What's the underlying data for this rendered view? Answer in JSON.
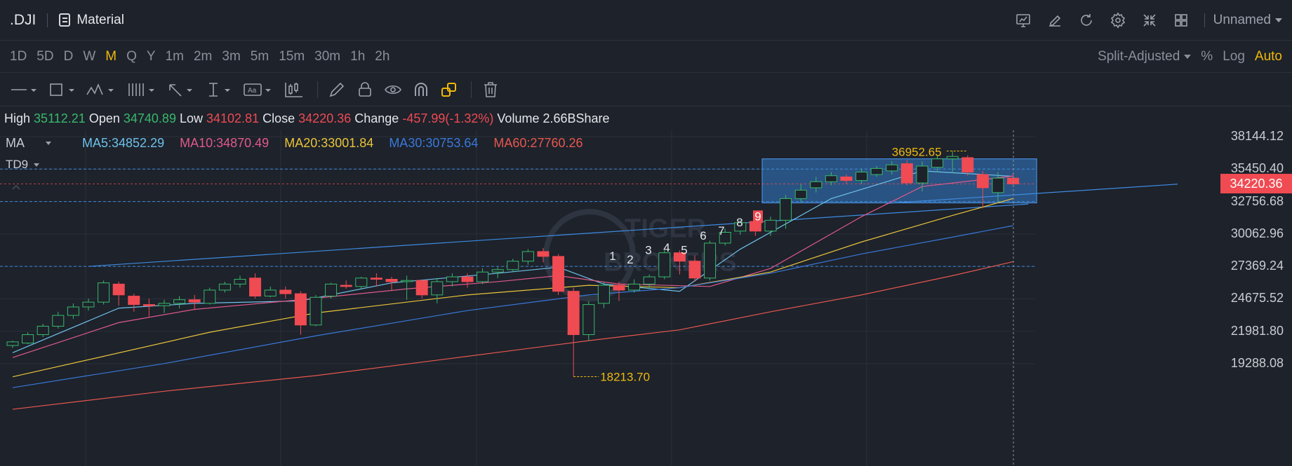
{
  "header": {
    "symbol": ".DJI",
    "layout_name": "Material",
    "icons": [
      "chart-screen-icon",
      "edit-icon",
      "refresh-icon",
      "settings-icon",
      "compress-icon",
      "grid-layout-icon"
    ],
    "account": "Unnamed"
  },
  "periods": [
    "1D",
    "5D",
    "D",
    "W",
    "M",
    "Q",
    "Y",
    "1m",
    "2m",
    "3m",
    "5m",
    "15m",
    "30m",
    "1h",
    "2h"
  ],
  "active_period": "M",
  "adjust": {
    "mode": "Split-Adjusted",
    "percent": "%",
    "log": "Log",
    "auto": "Auto"
  },
  "tools": [
    "line-tool-icon",
    "rectangle-tool-icon",
    "pattern-tool-icon",
    "fib-tool-icon",
    "arrow-tool-icon",
    "measure-tool-icon",
    "text-tool-icon",
    "indicator-icon",
    "pencil-icon",
    "lock-icon",
    "eye-icon",
    "magnet-icon",
    "link-icon",
    "trash-icon"
  ],
  "ohlc": {
    "high_label": "High",
    "high": "35112.21",
    "open_label": "Open",
    "open": "34740.89",
    "low_label": "Low",
    "low": "34102.81",
    "close_label": "Close",
    "close": "34220.36",
    "change_label": "Change",
    "change": "-457.99(-1.32%)",
    "volume_label": "Volume",
    "volume": "2.66BShare"
  },
  "indicators": {
    "ma_label": "MA",
    "ma5": "MA5:34852.29",
    "ma10": "MA10:34870.49",
    "ma20": "MA20:33001.84",
    "ma30": "MA30:30753.64",
    "ma60": "MA60:27760.26",
    "td_label": "TD9"
  },
  "colors": {
    "up": "#39b86b",
    "down": "#f04a52",
    "ma5": "#6ec1ea",
    "ma10": "#e0598b",
    "ma20": "#e9c43a",
    "ma30": "#3a78d8",
    "ma60": "#e8574e",
    "accent": "#f0b90b",
    "selection": "#2f6eb0"
  },
  "chart_data": {
    "type": "candlestick",
    "y_ticks": [
      "38144.12",
      "35450.40",
      "32756.68",
      "30062.96",
      "27369.24",
      "24675.52",
      "21981.80",
      "19288.08"
    ],
    "last_price": "34220.36",
    "high_marker": "36952.65",
    "low_marker": "18213.70",
    "td_counts": [
      "1",
      "2",
      "3",
      "4",
      "5",
      "6",
      "7",
      "8",
      "9"
    ],
    "watermark": [
      "TIGER",
      "BROKERS"
    ],
    "candles": [
      [
        20800,
        21100,
        20600,
        21200
      ],
      [
        21000,
        21700,
        20900,
        21900
      ],
      [
        21700,
        22400,
        21500,
        22600
      ],
      [
        22400,
        23300,
        22200,
        23600
      ],
      [
        23300,
        24000,
        23000,
        24300
      ],
      [
        24000,
        24400,
        23700,
        24700
      ],
      [
        24400,
        26000,
        24200,
        26200
      ],
      [
        25900,
        25000,
        24100,
        26100
      ],
      [
        24900,
        24200,
        23600,
        25100
      ],
      [
        24200,
        24100,
        23200,
        24700
      ],
      [
        24100,
        24300,
        23500,
        24600
      ],
      [
        24300,
        24600,
        23900,
        24900
      ],
      [
        24600,
        24400,
        23800,
        25000
      ],
      [
        24300,
        25400,
        24200,
        25600
      ],
      [
        25400,
        25900,
        25200,
        26100
      ],
      [
        25900,
        26300,
        25600,
        26600
      ],
      [
        26400,
        24900,
        24700,
        26800
      ],
      [
        24900,
        25400,
        24800,
        25700
      ],
      [
        25400,
        25100,
        24700,
        25700
      ],
      [
        25100,
        22500,
        21700,
        25300
      ],
      [
        22500,
        24800,
        22400,
        25000
      ],
      [
        24900,
        25900,
        24700,
        26000
      ],
      [
        25800,
        25700,
        25500,
        26200
      ],
      [
        25700,
        26400,
        25500,
        26500
      ],
      [
        26400,
        26300,
        25700,
        26800
      ],
      [
        26300,
        26100,
        25400,
        26500
      ],
      [
        26100,
        26200,
        24600,
        26600
      ],
      [
        26200,
        25000,
        24700,
        26200
      ],
      [
        25000,
        26100,
        24300,
        26400
      ],
      [
        26100,
        26500,
        25700,
        26800
      ],
      [
        26500,
        26100,
        25600,
        26800
      ],
      [
        26100,
        26900,
        25900,
        27200
      ],
      [
        26900,
        27100,
        26400,
        27300
      ],
      [
        27100,
        27800,
        26900,
        28000
      ],
      [
        27800,
        28600,
        27500,
        28800
      ],
      [
        28600,
        28200,
        27700,
        28900
      ],
      [
        28200,
        25300,
        25000,
        28400
      ],
      [
        25300,
        21700,
        18214,
        25600
      ],
      [
        21700,
        24200,
        21200,
        24500
      ],
      [
        24300,
        25800,
        23900,
        26100
      ],
      [
        25800,
        25400,
        24500,
        26100
      ],
      [
        25400,
        25900,
        25200,
        26300
      ],
      [
        25900,
        26500,
        25500,
        26700
      ],
      [
        26500,
        28500,
        26300,
        28700
      ],
      [
        28500,
        27800,
        26700,
        28700
      ],
      [
        27800,
        26400,
        26100,
        28300
      ],
      [
        26400,
        29300,
        26200,
        29500
      ],
      [
        29300,
        30200,
        29100,
        30500
      ],
      [
        30300,
        31000,
        30000,
        31200
      ],
      [
        31100,
        30300,
        29900,
        31300
      ],
      [
        30300,
        31200,
        29900,
        31500
      ],
      [
        31200,
        33000,
        30500,
        33300
      ],
      [
        33000,
        33700,
        32700,
        34200
      ],
      [
        33900,
        34400,
        33500,
        34800
      ],
      [
        34400,
        34900,
        34100,
        35200
      ],
      [
        34800,
        34500,
        34200,
        35000
      ],
      [
        34500,
        35200,
        34200,
        35500
      ],
      [
        35000,
        35500,
        34800,
        35700
      ],
      [
        35300,
        35800,
        35000,
        36100
      ],
      [
        35900,
        34300,
        34100,
        36200
      ],
      [
        34300,
        35700,
        33600,
        36100
      ],
      [
        35600,
        36300,
        35200,
        36600
      ],
      [
        36300,
        36500,
        35100,
        36953
      ],
      [
        36400,
        35200,
        34900,
        36600
      ],
      [
        35000,
        33900,
        32200,
        35300
      ],
      [
        33500,
        34700,
        32700,
        35200
      ],
      [
        34700,
        34220,
        34103,
        35112
      ]
    ],
    "ma_lines": {
      "MA5": [
        [
          0,
          20200
        ],
        [
          7,
          23900
        ],
        [
          12,
          24300
        ],
        [
          19,
          24500
        ],
        [
          25,
          26000
        ],
        [
          32,
          26800
        ],
        [
          36,
          27300
        ],
        [
          39,
          25900
        ],
        [
          44,
          25300
        ],
        [
          48,
          28800
        ],
        [
          54,
          33000
        ],
        [
          60,
          35300
        ],
        [
          66,
          34852
        ]
      ],
      "MA10": [
        [
          0,
          19800
        ],
        [
          7,
          22700
        ],
        [
          12,
          23800
        ],
        [
          19,
          24600
        ],
        [
          26,
          25500
        ],
        [
          32,
          26100
        ],
        [
          36,
          26600
        ],
        [
          40,
          25900
        ],
        [
          46,
          25700
        ],
        [
          50,
          27200
        ],
        [
          56,
          31500
        ],
        [
          60,
          34000
        ],
        [
          66,
          34870
        ]
      ],
      "MA20": [
        [
          0,
          18200
        ],
        [
          6,
          19900
        ],
        [
          13,
          21900
        ],
        [
          20,
          23500
        ],
        [
          30,
          25000
        ],
        [
          38,
          25800
        ],
        [
          44,
          25600
        ],
        [
          50,
          26900
        ],
        [
          56,
          29400
        ],
        [
          62,
          31600
        ],
        [
          66,
          33002
        ]
      ],
      "MA30": [
        [
          0,
          17300
        ],
        [
          10,
          19300
        ],
        [
          20,
          21600
        ],
        [
          30,
          23700
        ],
        [
          38,
          25000
        ],
        [
          44,
          25600
        ],
        [
          50,
          26800
        ],
        [
          56,
          28400
        ],
        [
          62,
          29800
        ],
        [
          66,
          30754
        ]
      ],
      "MA60": [
        [
          0,
          15500
        ],
        [
          10,
          17000
        ],
        [
          20,
          18300
        ],
        [
          30,
          19900
        ],
        [
          38,
          21200
        ],
        [
          44,
          22100
        ],
        [
          50,
          23600
        ],
        [
          56,
          25000
        ],
        [
          62,
          26600
        ],
        [
          66,
          27760
        ]
      ]
    },
    "h_lines": [
      35450.4,
      32756.68,
      27369.24
    ],
    "ylim": [
      17800,
      38900
    ]
  }
}
